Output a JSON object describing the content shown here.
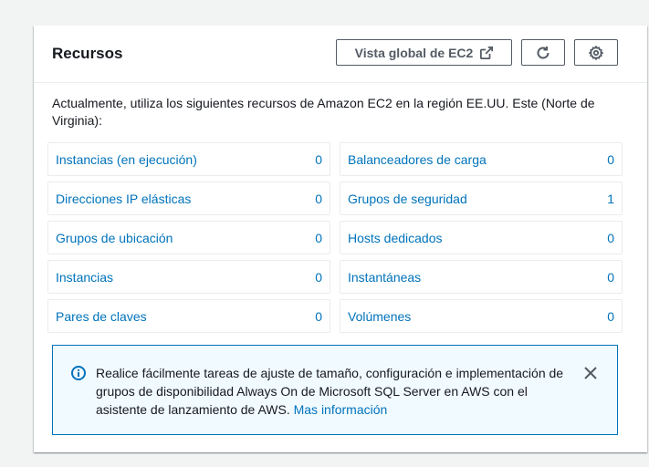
{
  "header": {
    "title": "Recursos",
    "global_view_label": "Vista global de EC2",
    "external_link_icon": "external-link-icon",
    "refresh_icon": "refresh-icon",
    "settings_icon": "gear-icon"
  },
  "intro_text": "Actualmente, utiliza los siguientes recursos de Amazon EC2 en la región EE.UU. Este (Norte de Virginia):",
  "resources": {
    "left": [
      {
        "label": "Instancias (en ejecución)",
        "count": "0"
      },
      {
        "label": "Direcciones IP elásticas",
        "count": "0"
      },
      {
        "label": "Grupos de ubicación",
        "count": "0"
      },
      {
        "label": "Instancias",
        "count": "0"
      },
      {
        "label": "Pares de claves",
        "count": "0"
      }
    ],
    "right": [
      {
        "label": "Balanceadores de carga",
        "count": "0"
      },
      {
        "label": "Grupos de seguridad",
        "count": "1"
      },
      {
        "label": "Hosts dedicados",
        "count": "0"
      },
      {
        "label": "Instantáneas",
        "count": "0"
      },
      {
        "label": "Volúmenes",
        "count": "0"
      }
    ]
  },
  "info": {
    "icon": "info-icon",
    "text": "Realice fácilmente tareas de ajuste de tamaño, configuración e implementación de grupos de disponibilidad Always On de Microsoft SQL Server en AWS con el asistente de lanzamiento de AWS.",
    "link_label": "Mas información",
    "close_icon": "close-icon"
  },
  "colors": {
    "link": "#0073bb",
    "border": "#eaeded",
    "info_bg": "#f1faff",
    "button_text": "#545b64"
  }
}
